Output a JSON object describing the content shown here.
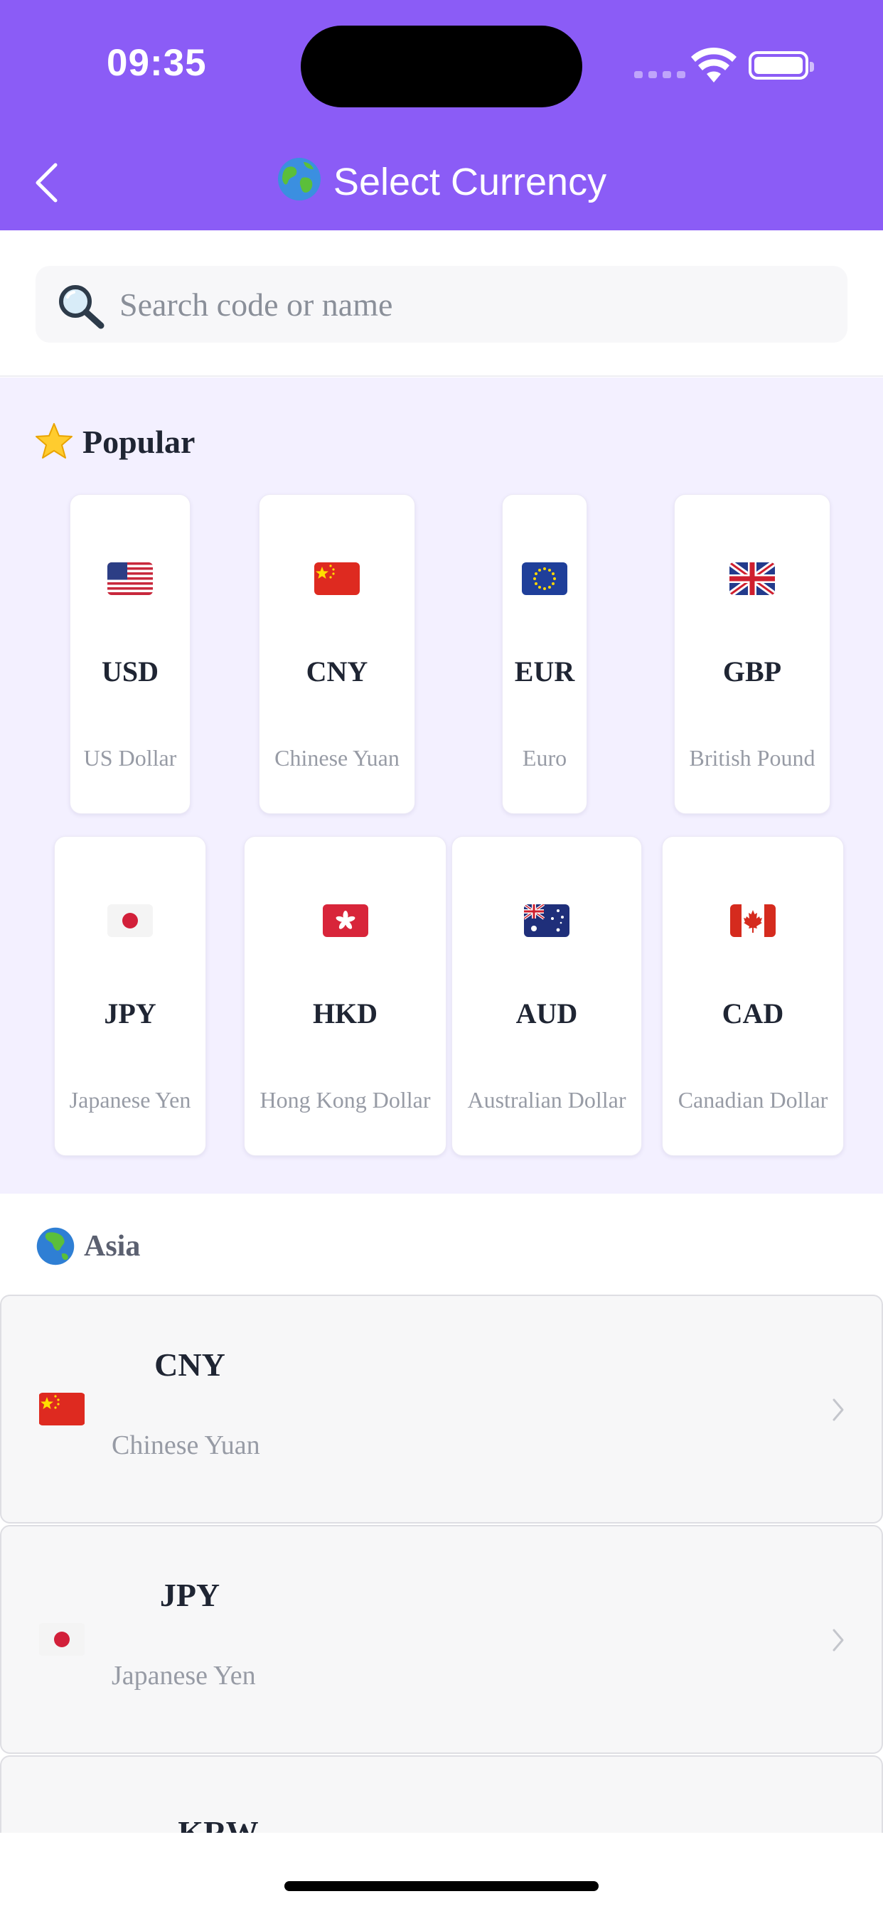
{
  "status_bar": {
    "time": "09:35"
  },
  "header": {
    "title": "Select Currency",
    "title_icon": "globe-icon",
    "back_icon": "chevron-left-icon"
  },
  "search": {
    "placeholder": "Search code or name",
    "icon": "search-icon"
  },
  "popular": {
    "title": "Popular",
    "icon": "star-icon",
    "items": [
      {
        "code": "USD",
        "name": "US Dollar",
        "flag": "us-flag-icon"
      },
      {
        "code": "CNY",
        "name": "Chinese Yuan",
        "flag": "china-flag-icon"
      },
      {
        "code": "EUR",
        "name": "Euro",
        "flag": "eu-flag-icon"
      },
      {
        "code": "GBP",
        "name": "British Pound",
        "flag": "uk-flag-icon"
      },
      {
        "code": "JPY",
        "name": "Japanese Yen",
        "flag": "japan-flag-icon"
      },
      {
        "code": "HKD",
        "name": "Hong Kong Dollar",
        "flag": "hong-kong-flag-icon"
      },
      {
        "code": "AUD",
        "name": "Australian Dollar",
        "flag": "australia-flag-icon"
      },
      {
        "code": "CAD",
        "name": "Canadian Dollar",
        "flag": "canada-flag-icon"
      }
    ]
  },
  "asia": {
    "title": "Asia",
    "icon": "globe-icon",
    "items": [
      {
        "code": "CNY",
        "name": "Chinese Yuan",
        "flag": "china-flag-icon"
      },
      {
        "code": "JPY",
        "name": "Japanese Yen",
        "flag": "japan-flag-icon"
      },
      {
        "code": "KRW",
        "name": "",
        "flag": ""
      }
    ]
  },
  "colors": {
    "header": "#8b5cf6",
    "popular_bg": "#f3f0ff",
    "code_text": "#1f2533",
    "name_text": "#979ba5"
  }
}
